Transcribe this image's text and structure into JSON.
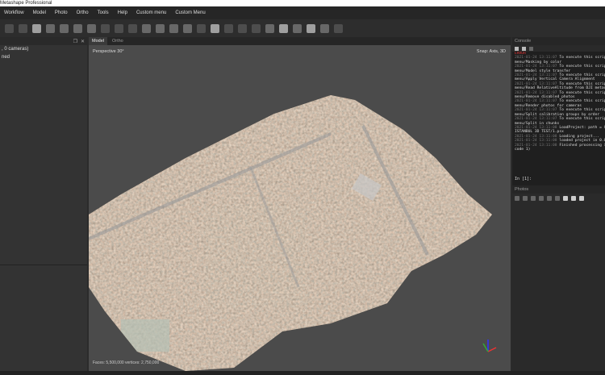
{
  "app_title": "Metashape Professional",
  "menu": [
    "Workflow",
    "Model",
    "Photo",
    "Ortho",
    "Tools",
    "Help",
    "Custom menu",
    "Custom Menu"
  ],
  "left_panel": {
    "rows": [
      ", 0 cameras)",
      "ned"
    ]
  },
  "view_tabs": [
    "Model",
    "Ortho"
  ],
  "viewport": {
    "projection": "Perspective 30°",
    "snap": "Snap: Axis, 3D",
    "stats": "Faces: 5,500,000 vertices: 2,750,000"
  },
  "console": {
    "title": "Console",
    "lines": [
      {
        "ts": "",
        "text": "",
        "err": "ERROR"
      },
      {
        "ts": "2021-01-24 13:11:07",
        "text": " To execute this script press Custom"
      },
      {
        "ts": "",
        "text": "menu/Masking by color"
      },
      {
        "ts": "2021-01-24 13:11:07",
        "text": " To execute this script press Custom"
      },
      {
        "ts": "",
        "text": "menu/Model style transfer"
      },
      {
        "ts": "2021-01-24 13:11:07",
        "text": " To execute this script press Custom"
      },
      {
        "ts": "",
        "text": "menu/Apply Vertical Camera Alignment"
      },
      {
        "ts": "2021-01-24 13:11:07",
        "text": " To execute this script press Custom"
      },
      {
        "ts": "",
        "text": "menu/Read RelativeAltitude from DJI metadata"
      },
      {
        "ts": "2021-01-24 13:11:07",
        "text": " To execute this script press Custom"
      },
      {
        "ts": "",
        "text": "menu/Remove disabled photos"
      },
      {
        "ts": "2021-01-24 13:11:07",
        "text": " To execute this script press Custom"
      },
      {
        "ts": "",
        "text": "menu/Render photos for cameras"
      },
      {
        "ts": "2021-01-24 13:11:07",
        "text": " To execute this script press Custom"
      },
      {
        "ts": "",
        "text": "menu/Split calibration groups by order"
      },
      {
        "ts": "2021-01-24 13:11:07",
        "text": " To execute this script press Custom"
      },
      {
        "ts": "",
        "text": "menu/Split in chunks"
      },
      {
        "ts": "2021-01-24 13:11:08",
        "text": " LoadProject: path = C:/"
      },
      {
        "ts": "",
        "text": "ISTANBUL 3D TEST/1.psx"
      },
      {
        "ts": "2021-01-24 13:11:08",
        "text": " Loading project..."
      },
      {
        "ts": "2021-01-24 13:11:08",
        "text": " loaded project in 0.0s"
      },
      {
        "ts": "2021-01-24 13:11:08",
        "text": " Finished processing in"
      },
      {
        "ts": "",
        "text": "code 1)"
      }
    ],
    "prompt": "In [1]:"
  },
  "photos": {
    "title": "Photos"
  }
}
